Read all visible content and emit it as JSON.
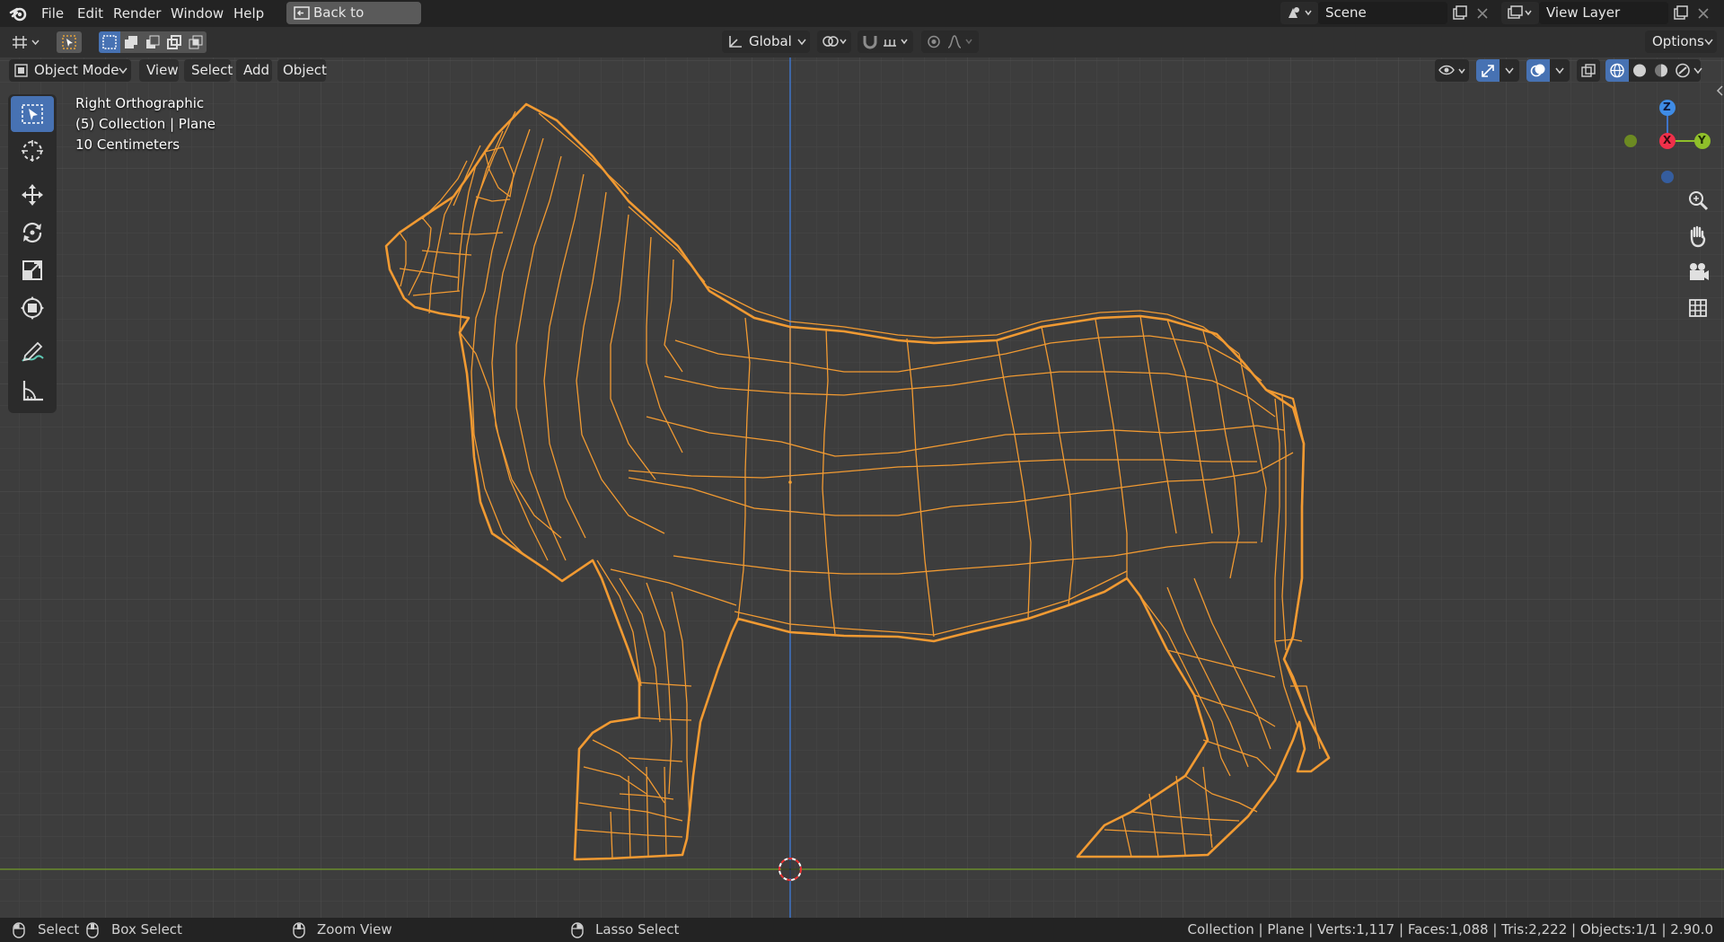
{
  "topbar": {
    "menu": [
      "File",
      "Edit",
      "Render",
      "Window",
      "Help"
    ],
    "back_button": "Back to Previous",
    "scene": "Scene",
    "view_layer": "View Layer"
  },
  "toolbar": {
    "orientation": "Global",
    "options": "Options"
  },
  "header": {
    "mode": "Object Mode",
    "menu": [
      "View",
      "Select",
      "Add",
      "Object"
    ]
  },
  "viewport": {
    "view_name": "Right Orthographic",
    "collection": "(5) Collection | Plane",
    "scale": "10 Centimeters",
    "gizmo": {
      "z": "Z",
      "x": "X",
      "y": "Y"
    },
    "colors": {
      "wire": "#f5a030",
      "grid_bg": "#3d3d3d",
      "y_axis": "#6a8c2c",
      "z_axis": "#3f74c8"
    }
  },
  "statusbar": {
    "select": "Select",
    "box_select": "Box Select",
    "zoom_view": "Zoom View",
    "lasso_select": "Lasso Select",
    "stats": "Collection | Plane | Verts:1,117 | Faces:1,088 | Tris:2,222 | Objects:1/1 | 2.90.0"
  },
  "icons": [
    "blender-logo-icon",
    "back-icon",
    "scene-icon",
    "view-layer-icon",
    "editor-type-icon",
    "select-mode-icon",
    "orientation-icon",
    "pivot-icon",
    "snap-icon",
    "proportional-icon",
    "visibility-icon",
    "gizmo-icon",
    "overlay-icon",
    "xray-icon",
    "wireframe-shading-icon",
    "solid-shading-icon",
    "material-shading-icon",
    "rendered-shading-icon",
    "select-box-tool-icon",
    "cursor-tool-icon",
    "move-tool-icon",
    "rotate-tool-icon",
    "scale-tool-icon",
    "transform-tool-icon",
    "annotate-tool-icon",
    "measure-tool-icon",
    "zoom-icon",
    "pan-hand-icon",
    "camera-icon",
    "grid-icon",
    "mouse-left-icon",
    "mouse-middle-icon",
    "mouse-right-icon"
  ]
}
